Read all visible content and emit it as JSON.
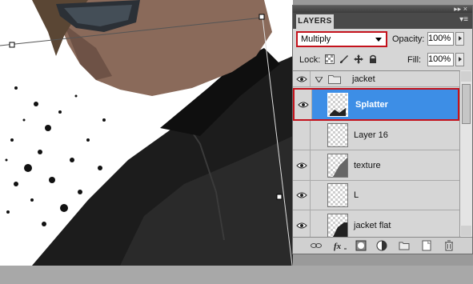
{
  "panel": {
    "tab_label": "LAYERS",
    "blend_mode": "Multiply",
    "opacity_label": "Opacity:",
    "opacity_value": "100%",
    "lock_label": "Lock:",
    "fill_label": "Fill:",
    "fill_value": "100%"
  },
  "layers": [
    {
      "name": "jacket",
      "type": "group",
      "visible": true
    },
    {
      "name": "Splatter",
      "type": "layer",
      "visible": true,
      "selected": true
    },
    {
      "name": "Layer 16",
      "type": "layer",
      "visible": false
    },
    {
      "name": "texture",
      "type": "layer",
      "visible": true
    },
    {
      "name": "L",
      "type": "layer",
      "visible": true
    },
    {
      "name": "jacket flat",
      "type": "layer",
      "visible": true
    }
  ],
  "toolbar_icons": [
    "link-icon",
    "fx-icon",
    "mask-icon",
    "adjustment-icon",
    "folder-icon",
    "new-layer-icon",
    "trash-icon"
  ],
  "colors": {
    "selection": "#3d8ee6",
    "highlight_border": "#c4121c",
    "panel_bg": "#d6d6d6"
  }
}
